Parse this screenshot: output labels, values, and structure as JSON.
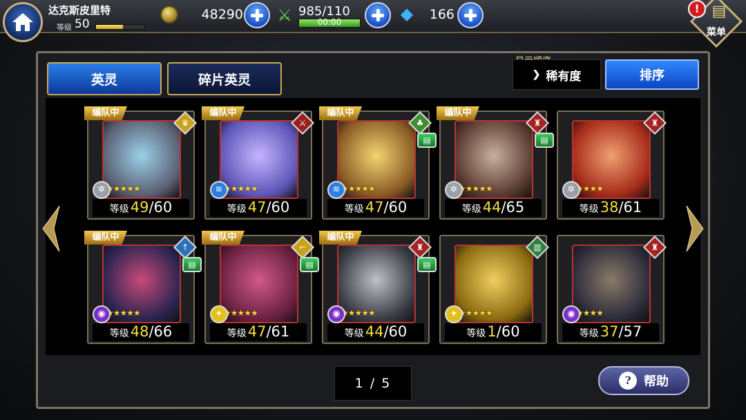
{
  "header": {
    "player_name": "达克斯皮里特",
    "level_label": "等级",
    "level": "50",
    "xp_fraction": 0.55,
    "gold": "48290",
    "stamina": "985/110",
    "stamina_timer": "00:00",
    "crystal": "166",
    "menu_label": "菜单",
    "alert_symbol": "!"
  },
  "tabs": [
    {
      "label": "英灵",
      "active": true
    },
    {
      "label": "碎片英灵",
      "active": false
    }
  ],
  "sort": {
    "order_label": "显示顺序",
    "current": "稀有度",
    "button": "排序"
  },
  "cards": [
    {
      "in_party": true,
      "party_label": "编队中",
      "level_label": "等级",
      "level": "49",
      "max": "/60",
      "element": "wind",
      "class": "crown",
      "book": false,
      "stars": 5,
      "colors": [
        "#5b5f72",
        "#9ad1e9"
      ]
    },
    {
      "in_party": true,
      "party_label": "编队中",
      "level_label": "等级",
      "level": "47",
      "max": "/60",
      "element": "water",
      "class": "sword",
      "book": false,
      "stars": 5,
      "colors": [
        "#5d56b8",
        "#c6b4ff"
      ]
    },
    {
      "in_party": true,
      "party_label": "编队中",
      "level_label": "等级",
      "level": "47",
      "max": "/60",
      "element": "water",
      "class": "forest",
      "book": true,
      "stars": 5,
      "colors": [
        "#8a5a25",
        "#f2d571"
      ]
    },
    {
      "in_party": true,
      "party_label": "编队中",
      "level_label": "等级",
      "level": "44",
      "max": "/65",
      "element": "wind",
      "class": "knight",
      "book": true,
      "stars": 5,
      "colors": [
        "#5a3a30",
        "#c8b0a0"
      ]
    },
    {
      "in_party": false,
      "party_label": "",
      "level_label": "等级",
      "level": "38",
      "max": "/61",
      "element": "wind",
      "class": "knight",
      "book": false,
      "stars": 4,
      "colors": [
        "#a52a1a",
        "#f0a070"
      ]
    },
    {
      "in_party": true,
      "party_label": "编队中",
      "level_label": "等级",
      "level": "48",
      "max": "/66",
      "element": "dark",
      "class": "lance",
      "book": true,
      "stars": 5,
      "colors": [
        "#2a2450",
        "#c84a7a"
      ]
    },
    {
      "in_party": true,
      "party_label": "编队中",
      "level_label": "等级",
      "level": "47",
      "max": "/61",
      "element": "light",
      "class": "gun",
      "book": true,
      "stars": 5,
      "colors": [
        "#6a2040",
        "#d05a8a"
      ]
    },
    {
      "in_party": true,
      "party_label": "编队中",
      "level_label": "等级",
      "level": "44",
      "max": "/60",
      "element": "dark",
      "class": "knight",
      "book": true,
      "stars": 5,
      "colors": [
        "#3a3a44",
        "#c0c0c8"
      ]
    },
    {
      "in_party": false,
      "party_label": "",
      "level_label": "等级",
      "level": "1",
      "max": "/60",
      "element": "light",
      "class": "guard",
      "book": false,
      "stars": 5,
      "colors": [
        "#8a6a10",
        "#f0d060"
      ]
    },
    {
      "in_party": false,
      "party_label": "",
      "level_label": "等级",
      "level": "37",
      "max": "/57",
      "element": "dark",
      "class": "knight",
      "book": false,
      "stars": 4,
      "colors": [
        "#2a2a38",
        "#8a7a6a"
      ]
    }
  ],
  "pagination": "1 / 5",
  "help_label": "帮助",
  "help_symbol": "?",
  "element_colors": {
    "wind": "#9aa0aa",
    "water": "#2b7fe0",
    "dark": "#7b2fc9",
    "light": "#e3c21c"
  },
  "class_colors": {
    "crown": "#c9a21c",
    "sword": "#9b1f1f",
    "forest": "#3f8f2f",
    "knight": "#a52323",
    "lance": "#2d6fb8",
    "gun": "#c9a21c",
    "guard": "#2f7f3f"
  },
  "icons": {
    "home": "home-icon",
    "gold": "coin-icon",
    "stamina": "swords-icon",
    "crystal": "crystal-icon",
    "menu": "book-icon",
    "alert": "alert-icon"
  }
}
